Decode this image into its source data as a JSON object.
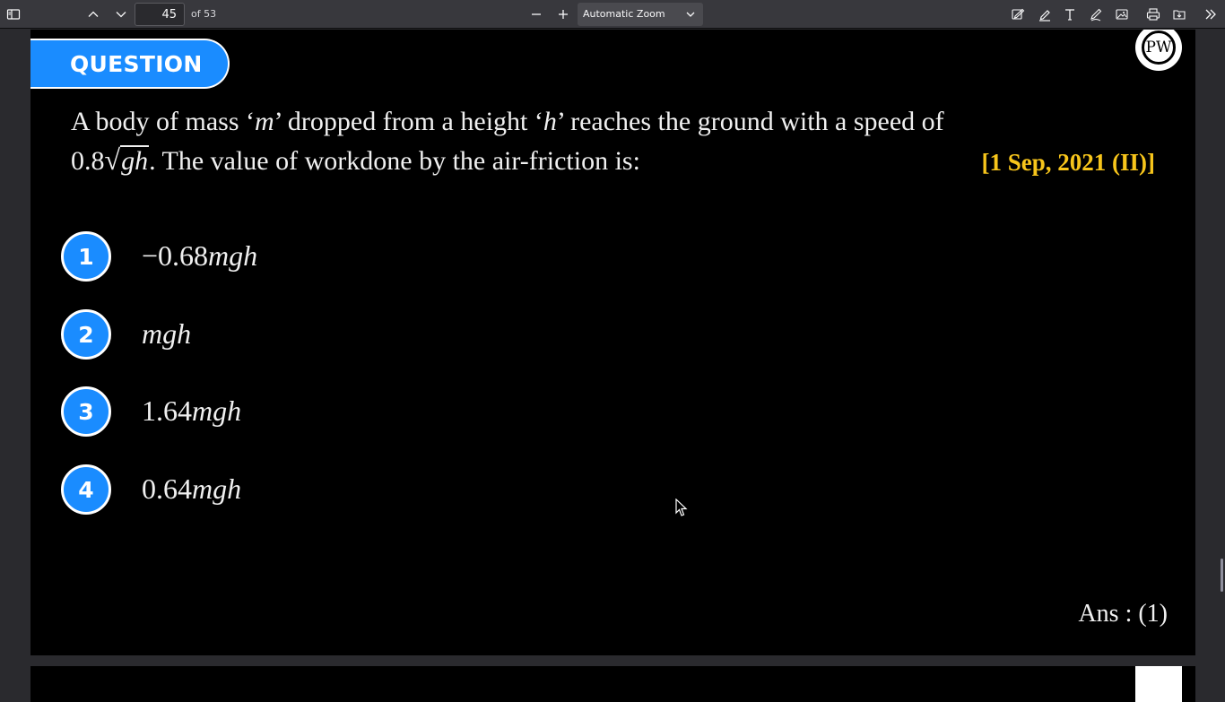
{
  "toolbar": {
    "page_number": "45",
    "page_count": "of 53",
    "zoom_label": "Automatic Zoom",
    "icons": [
      "sidebar-toggle-icon",
      "previous-page-icon",
      "next-page-icon",
      "zoom-out-icon",
      "zoom-in-icon",
      "chevron-down-icon",
      "sign-icon",
      "highlight-icon",
      "text-icon",
      "draw-icon",
      "image-icon",
      "print-icon",
      "save-icon",
      "more-tools-icon"
    ]
  },
  "slide": {
    "banner": "QUESTION",
    "logo_text": "PW",
    "question_line1_a": "A body of mass ‘",
    "question_m": "m",
    "question_line1_b": "’ dropped from a height ‘",
    "question_h": "h",
    "question_line1_c": "’ reaches the ground with a speed of",
    "speed_coeff": "0.8",
    "speed_radicand": "gh",
    "question_line2": ". The value of workdone by the air-friction is:",
    "date_tag": "[1 Sep, 2021 (II)]",
    "options": [
      {
        "num": "1",
        "coeff": "−0.68",
        "var": "mgh"
      },
      {
        "num": "2",
        "coeff": "",
        "var": "mgh"
      },
      {
        "num": "3",
        "coeff": "1.64",
        "var": "mgh"
      },
      {
        "num": "4",
        "coeff": "0.64",
        "var": "mgh"
      }
    ],
    "answer": "Ans : (1)"
  }
}
